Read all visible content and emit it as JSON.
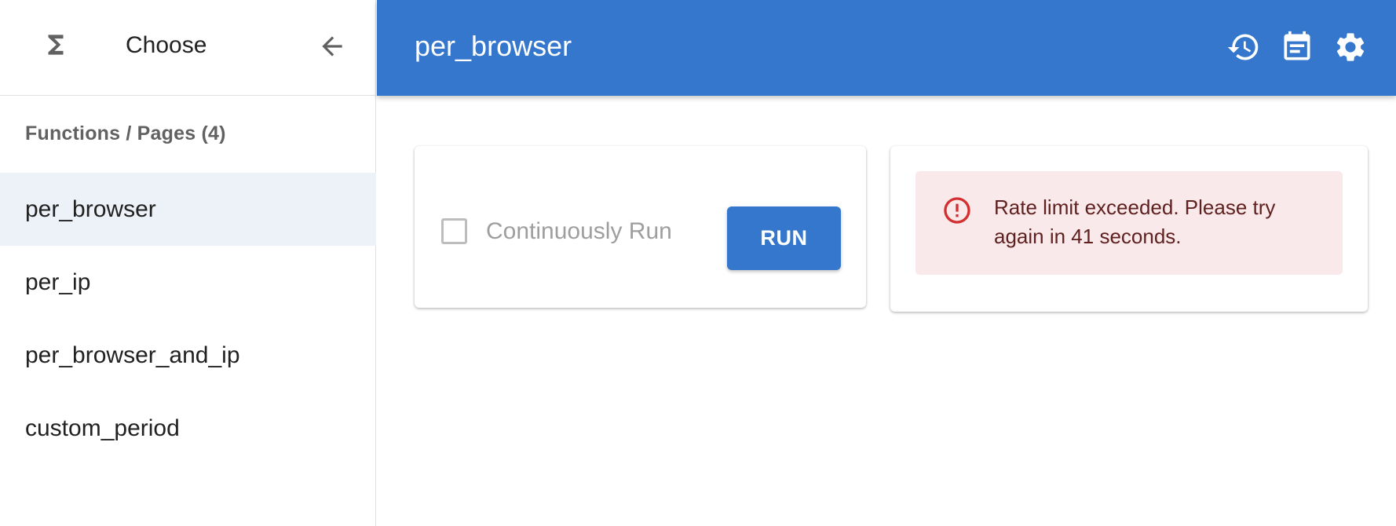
{
  "sidebar": {
    "title": "Choose",
    "section_label": "Functions / Pages (4)",
    "items": [
      {
        "label": "per_browser",
        "active": true
      },
      {
        "label": "per_ip",
        "active": false
      },
      {
        "label": "per_browser_and_ip",
        "active": false
      },
      {
        "label": "custom_period",
        "active": false
      }
    ],
    "icons": {
      "logo": "sigma-icon",
      "back": "arrow-back-icon"
    }
  },
  "header": {
    "title": "per_browser",
    "icons": [
      "history-icon",
      "calendar-note-icon",
      "settings-gear-icon"
    ],
    "color": "#3477cc"
  },
  "run_panel": {
    "checkbox_label": "Continuously Run",
    "checkbox_checked": false,
    "run_label": "RUN"
  },
  "alert": {
    "message": "Rate limit exceeded. Please try again in 41 seconds.",
    "severity": "error",
    "icon": "error-outline-icon",
    "background": "#f9e9ea",
    "icon_color": "#d32f2f"
  }
}
